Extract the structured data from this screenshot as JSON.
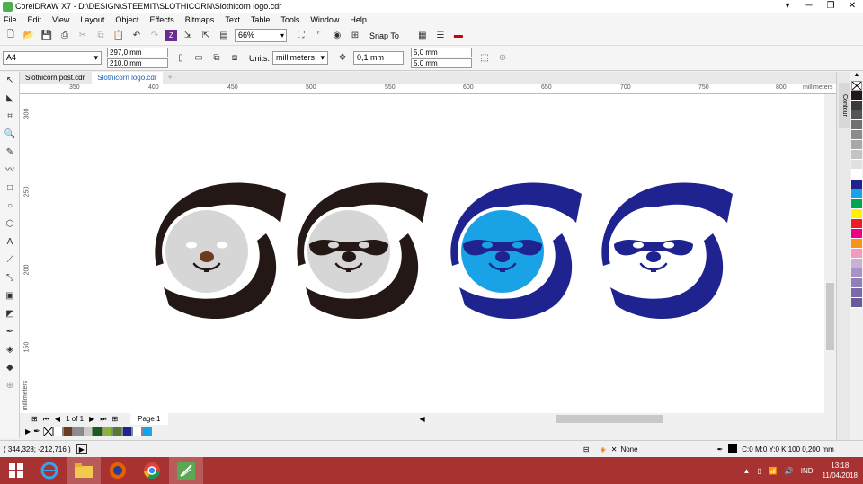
{
  "window": {
    "title": "CorelDRAW X7 - D:\\DESIGN\\STEEMIT\\SLOTHICORN\\Slothicorn logo.cdr",
    "controls": [
      "▾",
      "─",
      "❐",
      "✕"
    ]
  },
  "menu": [
    "File",
    "Edit",
    "View",
    "Layout",
    "Object",
    "Effects",
    "Bitmaps",
    "Text",
    "Table",
    "Tools",
    "Window",
    "Help"
  ],
  "toolbar": {
    "zoom": "66%",
    "snap_to": "Snap To"
  },
  "property_bar": {
    "page_size": "A4",
    "width": "297,0 mm",
    "height": "210,0 mm",
    "units_label": "Units:",
    "units": "millimeters",
    "nudge": "0,1 mm",
    "dup_x": "5,0 mm",
    "dup_y": "5,0 mm"
  },
  "tabs": [
    {
      "label": "Slothicorn post.cdr",
      "active": false
    },
    {
      "label": "Slothicorn logo.cdr",
      "active": true
    }
  ],
  "ruler": {
    "h_ticks": [
      "350",
      "400",
      "450",
      "500",
      "550",
      "600",
      "650",
      "700",
      "750",
      "800"
    ],
    "h_units": "millimeters",
    "v_ticks": [
      "300",
      "250",
      "200",
      "150"
    ],
    "v_units": "millimeters"
  },
  "logos": [
    {
      "s_color": "#231815",
      "face_color": "#d6d6d6",
      "mask_color": "#d6d6d6",
      "feature_color": "#231815",
      "nose_color": "#6b3a1f",
      "variant": "grey-brown"
    },
    {
      "s_color": "#231815",
      "face_color": "#d6d6d6",
      "mask_color": "#231815",
      "feature_color": "#231815",
      "nose_color": "#231815",
      "variant": "grey-black"
    },
    {
      "s_color": "#1f2390",
      "face_color": "#1aa2e6",
      "mask_color": "#1f2390",
      "feature_color": "#1f2390",
      "nose_color": "#1f2390",
      "variant": "blue"
    },
    {
      "s_color": "#1f2390",
      "face_color": "#ffffff",
      "mask_color": "#1f2390",
      "feature_color": "#1f2390",
      "nose_color": "#1f2390",
      "variant": "white-navy"
    }
  ],
  "page_nav": {
    "page_count": "1 of 1",
    "page_tab": "Page 1"
  },
  "doc_palette": [
    "#ffffff",
    "#6b3a1f",
    "#8c8c8c",
    "#c9c9c9",
    "#1a5c1a",
    "#8db33a",
    "#4f7f2e",
    "#1f2390",
    "#ffffff",
    "#1aa2e6"
  ],
  "status": {
    "coords": "( 344,328; -212,716 )",
    "fill_label": "None",
    "outline": "C:0 M:0 Y:0 K:100  0,200 mm"
  },
  "docker": {
    "contour": "Contour"
  },
  "color_palette": [
    "#231815",
    "#3a3a3a",
    "#555555",
    "#707070",
    "#8c8c8c",
    "#a8a8a8",
    "#c4c4c4",
    "#e0e0e0",
    "#ffffff",
    "#1f2390",
    "#1aa2e6",
    "#00a651",
    "#fff200",
    "#ed1c24",
    "#ec008c",
    "#f7941d",
    "#f49ac1",
    "#c7b2d6",
    "#a793c4",
    "#8f80b8",
    "#7a6ba8",
    "#6a5b98"
  ],
  "taskbar": {
    "language": "IND",
    "time": "13:18",
    "date": "11/04/2018"
  }
}
